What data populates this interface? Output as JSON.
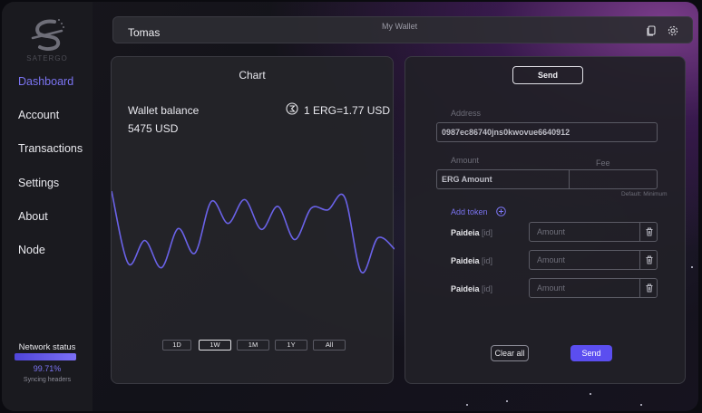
{
  "app": {
    "brand": "SATERGO",
    "accent": "#7b74f2"
  },
  "sidebar": {
    "items": [
      {
        "label": "Dashboard",
        "active": true
      },
      {
        "label": "Account"
      },
      {
        "label": "Transactions"
      },
      {
        "label": "Settings"
      },
      {
        "label": "About"
      },
      {
        "label": "Node"
      }
    ],
    "network": {
      "label": "Network status",
      "percent_text": "99.71%",
      "progress": 0.9971,
      "status": "Syncing headers"
    }
  },
  "header": {
    "user": "Tomas",
    "wallet_name": "My Wallet",
    "icons": [
      "copy-icon",
      "gear-icon"
    ]
  },
  "chart_panel": {
    "title": "Chart",
    "balance_label": "Wallet balance",
    "balance_value": "5475 USD",
    "rate_text": "1 ERG=1.77 USD",
    "ranges": [
      "1D",
      "1W",
      "1M",
      "1Y",
      "All"
    ],
    "active_range": "1W"
  },
  "chart_data": {
    "type": "line",
    "title": "Chart",
    "xlabel": "",
    "ylabel": "",
    "grid": false,
    "legend": "none",
    "color": "#6a62e8",
    "series": [
      {
        "values": [
          1.0,
          0.15,
          0.42,
          0.1,
          0.56,
          0.27,
          0.88,
          0.62,
          0.9,
          0.55,
          0.82,
          0.43,
          0.8,
          0.78,
          0.93,
          0.05,
          0.45,
          0.32
        ]
      }
    ]
  },
  "send_panel": {
    "tab_label": "Send",
    "address_label": "Address",
    "address_value": "0987ec86740jns0kwovue6640912",
    "amount_label": "Amount",
    "amount_value": "ERG Amount",
    "fee_label": "Fee",
    "fee_default": "Default: Minimum",
    "add_token_label": "Add token",
    "tokens": [
      {
        "name": "Paideia",
        "id_hint": "[id]",
        "placeholder": "Amount"
      },
      {
        "name": "Paideia",
        "id_hint": "[id]",
        "placeholder": "Amount"
      },
      {
        "name": "Paideia",
        "id_hint": "[id]",
        "placeholder": "Amount"
      }
    ],
    "clear_label": "Clear all",
    "send_label": "Send"
  }
}
